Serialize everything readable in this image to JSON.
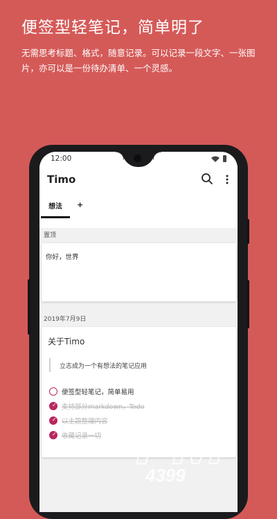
{
  "promo": {
    "headline": "便签型轻笔记，简单明了",
    "subtext": "无需思考标题、格式，随意记录。可以记录一段文字、一张图片，亦可以是一份待办清单、一个灵感。"
  },
  "status_bar": {
    "time": "12:00"
  },
  "app": {
    "title": "Timo",
    "tabs": [
      {
        "label": "想法",
        "active": true
      },
      {
        "label": "+"
      }
    ]
  },
  "sections": [
    {
      "label": "置顶",
      "cards": [
        {
          "text": "你好，世界"
        }
      ]
    },
    {
      "label": "2019年7月9日",
      "cards": [
        {
          "heading": "关于Timo",
          "quote": "立志成为一个有想法的笔记应用",
          "todos": [
            {
              "text": "便签型轻笔记，简单易用",
              "done": false
            },
            {
              "text": "支持部分markdown，Todo",
              "done": true
            },
            {
              "text": "以主题整理内容",
              "done": true
            },
            {
              "text": "收藏记录一切",
              "done": true
            }
          ]
        }
      ]
    }
  ],
  "watermark": {
    "brand": "FM",
    "number": "4399"
  },
  "colors": {
    "background": "#d45a58",
    "todo_accent": "#b8285e",
    "frame": "#1b1b1d"
  }
}
